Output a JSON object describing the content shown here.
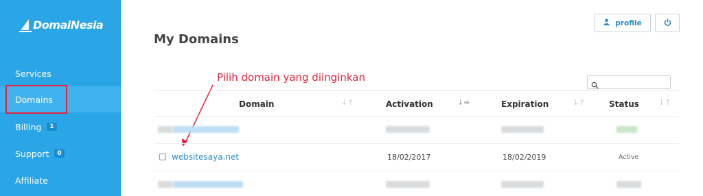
{
  "sidebar": {
    "logo_text": "DomaiNesia",
    "items": [
      {
        "label": "Services",
        "badge": null
      },
      {
        "label": "Domains",
        "badge": null
      },
      {
        "label": "Billing",
        "badge": "1"
      },
      {
        "label": "Support",
        "badge": "0"
      },
      {
        "label": "Affiliate",
        "badge": null
      }
    ]
  },
  "header": {
    "profile_label": "profile",
    "user_icon": "user-icon",
    "power_icon": "power-icon"
  },
  "main": {
    "title": "My Domains",
    "annotation": "Pilih domain yang diinginkan",
    "search_placeholder": ""
  },
  "table": {
    "columns": [
      "Domain",
      "Activation",
      "Expiration",
      "Status"
    ],
    "row_visible": {
      "domain": "websitesaya.net",
      "activation": "18/02/2017",
      "expiration": "18/02/2019",
      "status": "Active"
    }
  },
  "colors": {
    "sidebar": "#2aa5e6",
    "accent": "#2a89c9",
    "annotation": "#e2233d"
  }
}
